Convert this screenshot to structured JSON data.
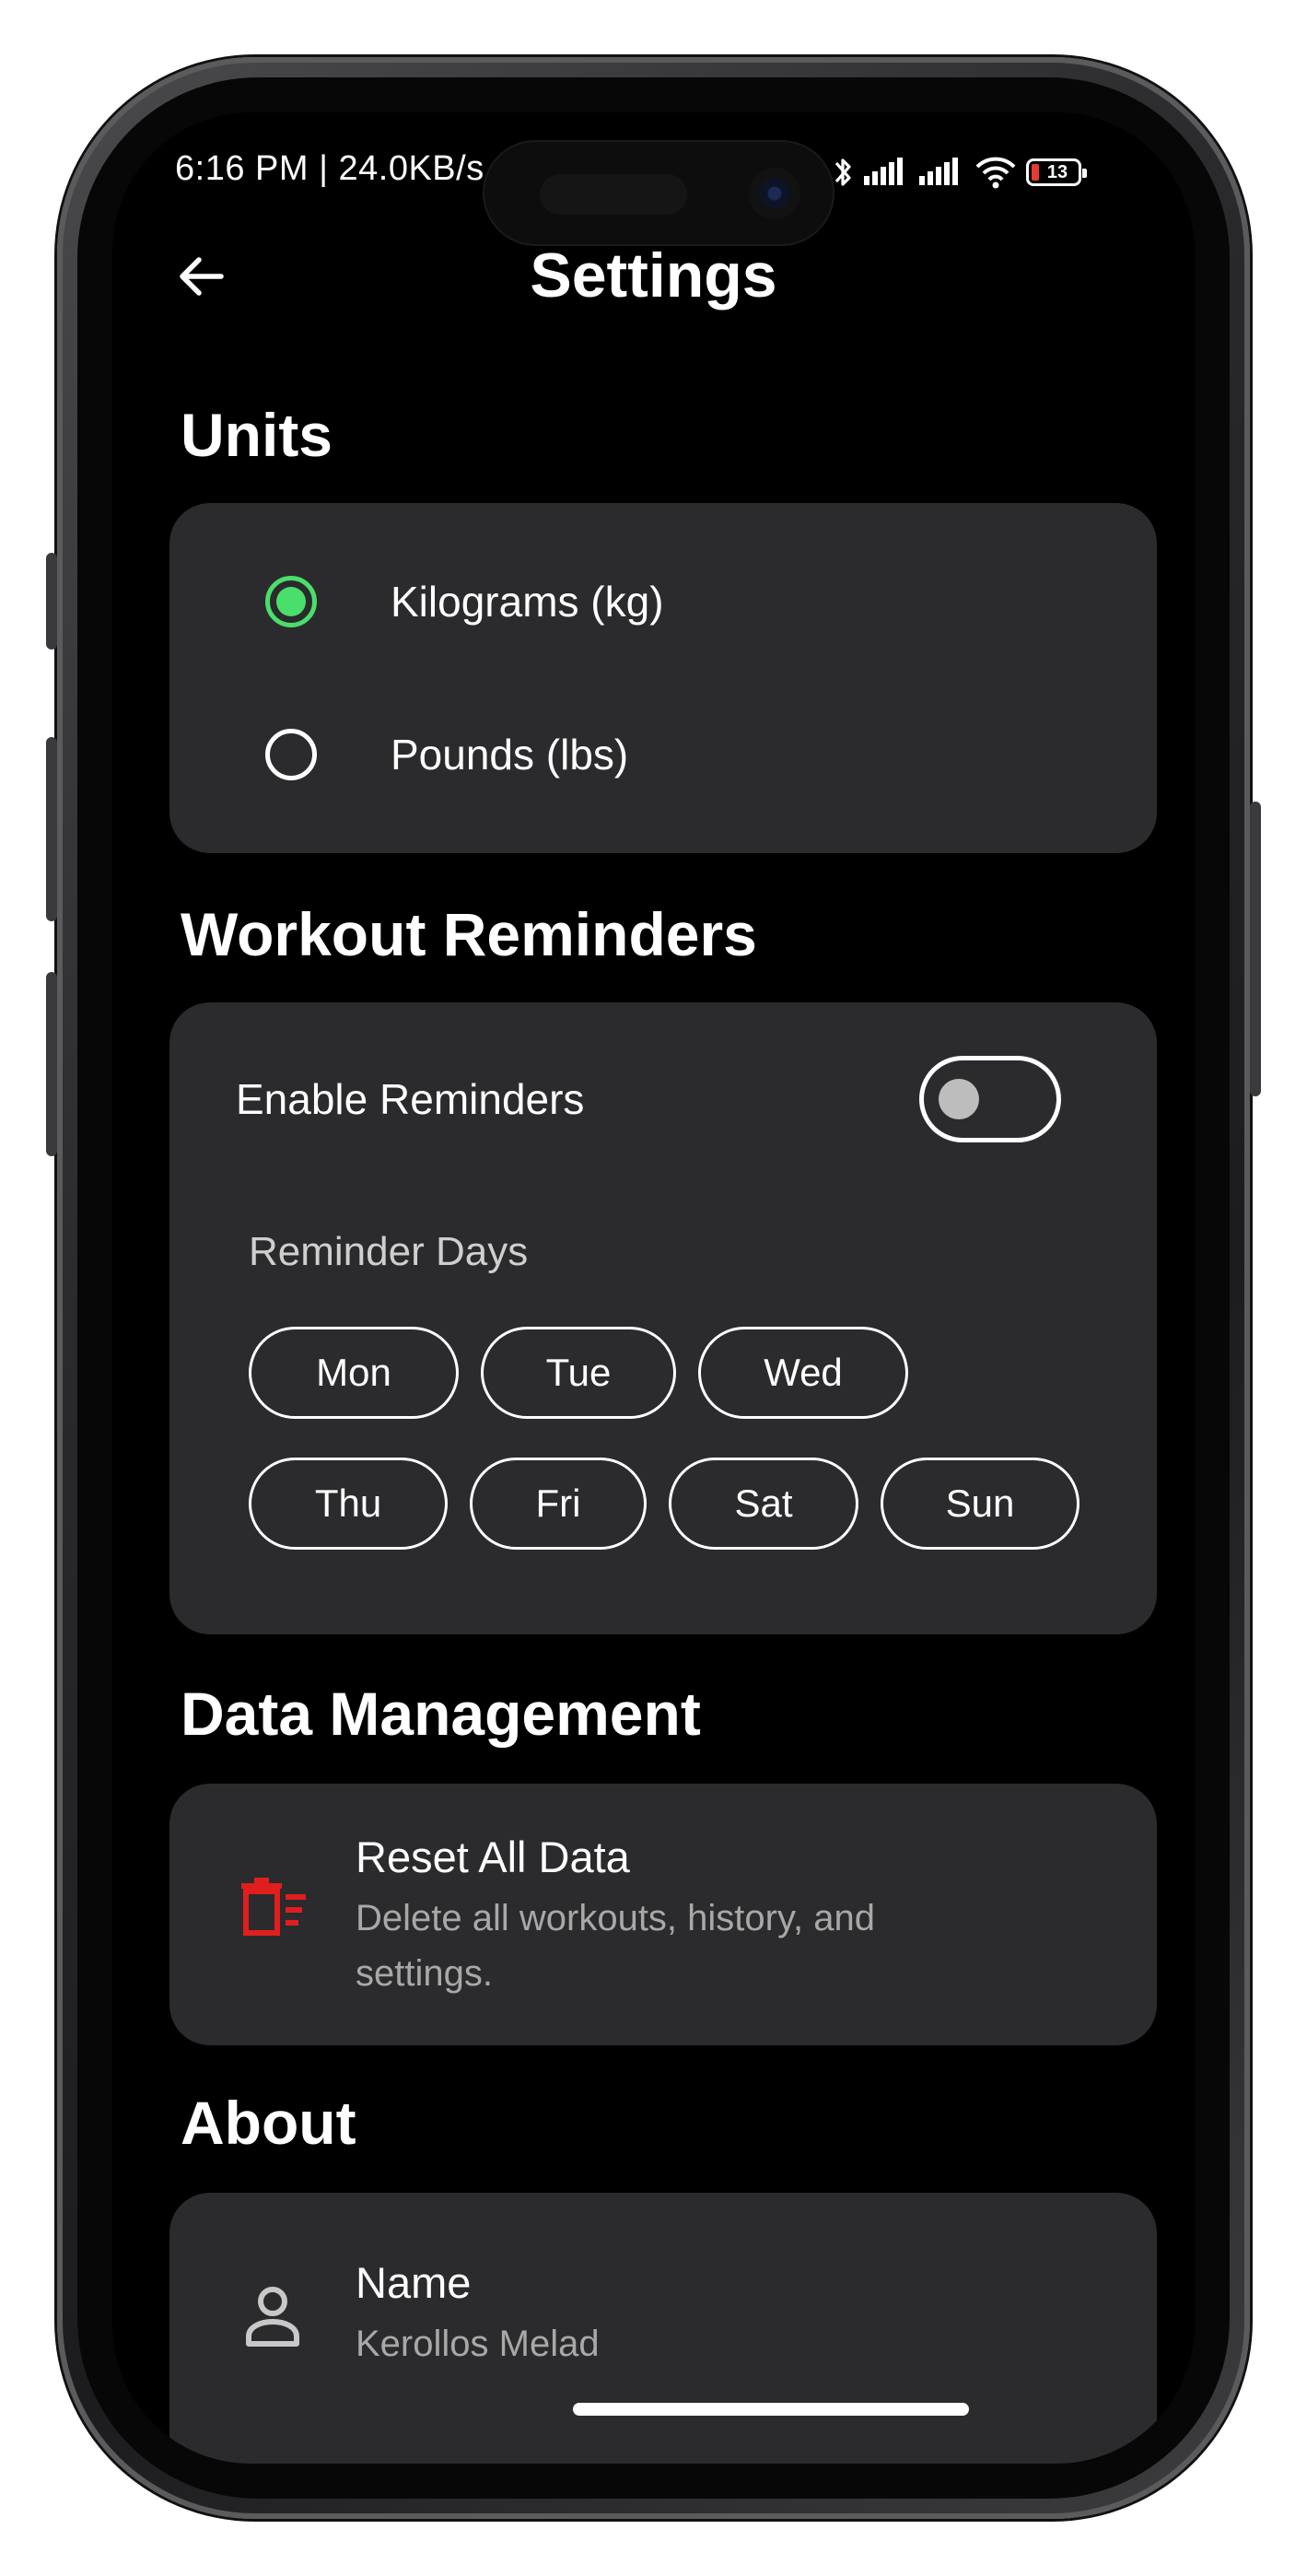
{
  "status_bar": {
    "time": "6:16 PM | 24.0KB/s",
    "battery_level": "13"
  },
  "header": {
    "title": "Settings",
    "back_icon": "arrow-left-icon"
  },
  "units": {
    "title": "Units",
    "options": [
      {
        "label": "Kilograms (kg)",
        "selected": true
      },
      {
        "label": "Pounds (lbs)",
        "selected": false
      }
    ]
  },
  "reminders": {
    "title": "Workout Reminders",
    "enable_label": "Enable Reminders",
    "enabled": false,
    "days_label": "Reminder Days",
    "days": [
      "Mon",
      "Tue",
      "Wed",
      "Thu",
      "Fri",
      "Sat",
      "Sun"
    ]
  },
  "data_management": {
    "title": "Data Management",
    "reset_title": "Reset All Data",
    "reset_description": "Delete all workouts, history, and settings.",
    "icon": "delete-sweep-icon",
    "accent_color": "#e01e1e"
  },
  "about": {
    "title": "About",
    "name_label": "Name",
    "name_value": "Kerollos Melad",
    "icon": "person-icon"
  },
  "colors": {
    "background": "#000000",
    "card": "#2b2b2d",
    "accent_green": "#4ade6b"
  }
}
